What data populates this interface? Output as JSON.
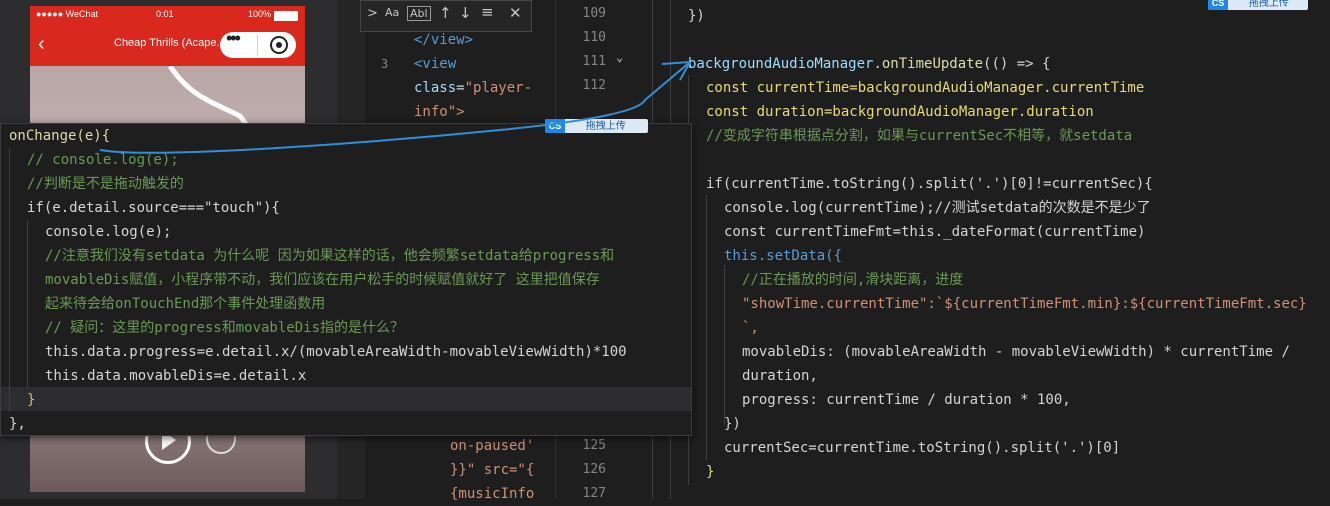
{
  "phone": {
    "carrier": "●●●●● WeChat",
    "time": "0:01",
    "battery": "100%",
    "nav_title": "Cheap Thrills (Acape...",
    "back_icon": "chevron-left-icon",
    "more_icon": "more-dots-icon",
    "close_icon": "target-icon"
  },
  "find": {
    "match_case": "Aa",
    "whole_word": "Abl",
    "toggle": ">"
  },
  "badges": {
    "top_right": "拖拽上传",
    "popup": "拖拽上传"
  },
  "mid": {
    "lines": [
      {
        "n": "109",
        "a": "</view>",
        "b": ""
      },
      {
        "n": "110",
        "a": "<view",
        "b": ""
      },
      {
        "n": "111",
        "a": "class=\"player-",
        "b": ""
      },
      {
        "n": "112",
        "a": "info\">",
        "b": ""
      },
      {
        "n": "125",
        "a": "on-paused'",
        "b": ""
      },
      {
        "n": "126",
        "a": "}}\" src=\"{",
        "b": ""
      },
      {
        "n": "127",
        "a": "{musicInfo",
        "b": ""
      }
    ],
    "fold_marker": "3"
  },
  "right": {
    "l0": "})",
    "l1_obj": "backgroundAudioManager",
    "l1_fn": "onTimeUpdate",
    "l1_rest": "(() => {",
    "l2": "const currentTime=backgroundAudioManager.currentTime",
    "l3": "const duration=backgroundAudioManager.duration",
    "l4": "//变成字符串根据点分割，如果与currentSec不相等，就setdata",
    "l6": "if(currentTime.toString().split('.')[0]!=currentSec){",
    "l7": "console.log(currentTime);//测试setdata的次数是不是少了",
    "l8": "const currentTimeFmt=this._dateFormat(currentTime)",
    "l9": "this.setData({",
    "l10": "//正在播放的时间,滑块距离，进度",
    "l11": "\"showTime.currentTime\":`${currentTimeFmt.min}:${currentTimeFmt.sec}",
    "l12": "`,",
    "l13": "movableDis: (movableAreaWidth - movableViewWidth) * currentTime /",
    "l14": "duration,",
    "l15": "progress: currentTime / duration * 100,",
    "l16": "})",
    "l17": "currentSec=currentTime.toString().split('.')[0]",
    "l18": "}"
  },
  "popup": {
    "p0": "onChange(e){",
    "p1": "// console.log(e);",
    "p2": "//判断是不是拖动触发的",
    "p3": "if(e.detail.source===\"touch\"){",
    "p4": "console.log(e);",
    "p5": "//注意我们没有setdata 为什么呢 因为如果这样的话，他会频繁setdata给progress和",
    "p6": "movableDis赋值，小程序带不动，我们应该在用户松手的时候赋值就好了 这里把值保存",
    "p7": "起来待会给onTouchEnd那个事件处理函数用",
    "p8": "// 疑问：这里的progress和movableDis指的是什么？",
    "p9": "this.data.progress=e.detail.x/(movableAreaWidth-movableViewWidth)*100",
    "p10": "this.data.movableDis=e.detail.x",
    "p11": "}",
    "p12": "},"
  }
}
